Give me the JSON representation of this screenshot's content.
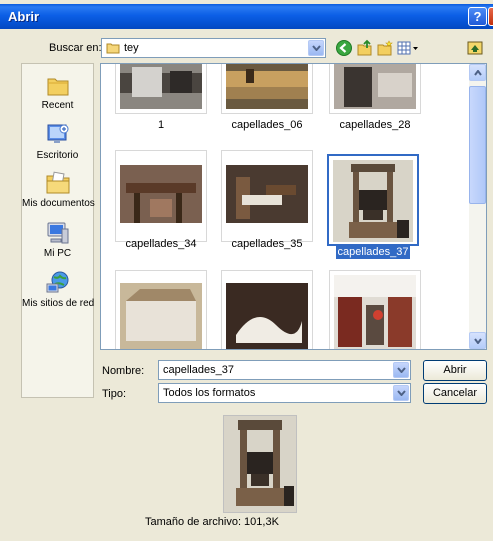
{
  "window": {
    "title": "Abrir"
  },
  "lookin": {
    "label": "Buscar en:",
    "value": "tey"
  },
  "places": [
    {
      "label": "Recent"
    },
    {
      "label": "Escritorio"
    },
    {
      "label": "Mis documentos"
    },
    {
      "label": "Mi PC"
    },
    {
      "label": "Mis sitios de red"
    }
  ],
  "files": [
    {
      "name": "1"
    },
    {
      "name": "capellades_06"
    },
    {
      "name": "capellades_28"
    },
    {
      "name": "capellades_34"
    },
    {
      "name": "capellades_35"
    },
    {
      "name": "capellades_37",
      "selected": true
    },
    {
      "name": ""
    },
    {
      "name": ""
    },
    {
      "name": ""
    }
  ],
  "filename": {
    "label": "Nombre:",
    "value": "capellades_37"
  },
  "filetype": {
    "label": "Tipo:",
    "value": "Todos los formatos"
  },
  "buttons": {
    "open": "Abrir",
    "cancel": "Cancelar"
  },
  "preview": {
    "size_text": "Tamaño de archivo: 101,3K"
  },
  "colors": {
    "titlebar": "#0450d0",
    "selection": "#316ac5",
    "dialog": "#ece9d8"
  }
}
